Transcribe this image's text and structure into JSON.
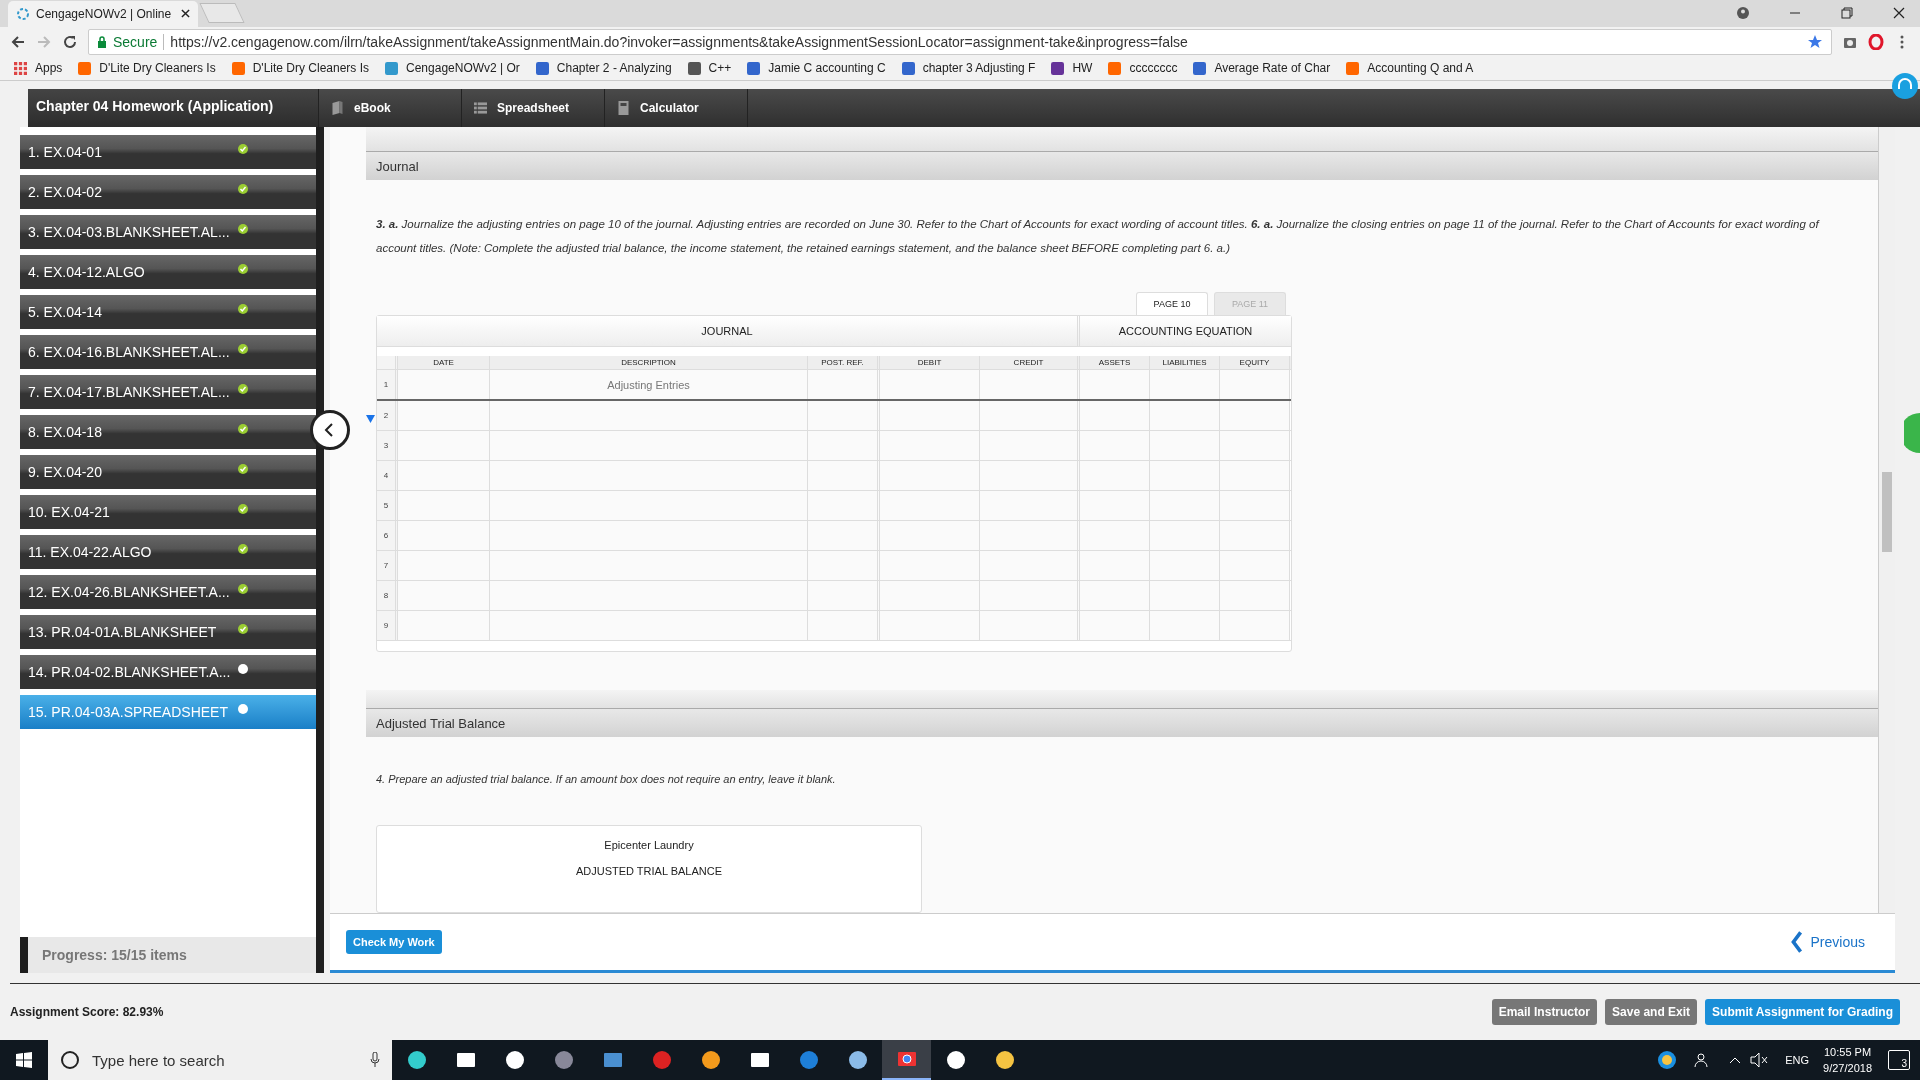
{
  "browser": {
    "tab_title": "CengageNOWv2 | Online",
    "secure_label": "Secure",
    "url": "https://v2.cengagenow.com/ilrn/takeAssignment/takeAssignmentMain.do?invoker=assignments&takeAssignmentSessionLocator=assignment-take&inprogress=false",
    "bookmarks": [
      "Apps",
      "D'Lite Dry Cleaners Is",
      "D'Lite Dry Cleaners Is",
      "CengageNOWv2 | Or",
      "Chapter 2 - Analyzing",
      "C++",
      "Jamie C accounting C",
      "chapter 3 Adjusting F",
      "HW",
      "cccccccc",
      "Average Rate of Char",
      "Accounting Q and A"
    ]
  },
  "assignment_title": "Chapter 04 Homework (Application)",
  "tools": [
    "eBook",
    "Spreadsheet",
    "Calculator"
  ],
  "sidebar": {
    "items": [
      {
        "label": "1. EX.04-01",
        "done": true,
        "selected": false
      },
      {
        "label": "2. EX.04-02",
        "done": true,
        "selected": false
      },
      {
        "label": "3. EX.04-03.BLANKSHEET.AL...",
        "done": true,
        "selected": false
      },
      {
        "label": "4. EX.04-12.ALGO",
        "done": true,
        "selected": false
      },
      {
        "label": "5. EX.04-14",
        "done": true,
        "selected": false
      },
      {
        "label": "6. EX.04-16.BLANKSHEET.AL...",
        "done": true,
        "selected": false
      },
      {
        "label": "7. EX.04-17.BLANKSHEET.AL...",
        "done": true,
        "selected": false
      },
      {
        "label": "8. EX.04-18",
        "done": true,
        "selected": false
      },
      {
        "label": "9. EX.04-20",
        "done": true,
        "selected": false
      },
      {
        "label": "10. EX.04-21",
        "done": true,
        "selected": false
      },
      {
        "label": "11. EX.04-22.ALGO",
        "done": true,
        "selected": false
      },
      {
        "label": "12. EX.04-26.BLANKSHEET.A...",
        "done": true,
        "selected": false
      },
      {
        "label": "13. PR.04-01A.BLANKSHEET",
        "done": true,
        "selected": false
      },
      {
        "label": "14. PR.04-02.BLANKSHEET.A...",
        "done": false,
        "selected": false
      },
      {
        "label": "15. PR.04-03A.SPREADSHEET",
        "done": false,
        "selected": true
      }
    ],
    "progress": "Progress:  15/15 items"
  },
  "journal": {
    "heading": "Journal",
    "instructions": "**3. a.** Journalize the adjusting entries on page 10 of the journal. Adjusting entries are recorded on June 30. Refer to the Chart of Accounts for exact wording of account titles. **6. a.** Journalize the closing entries on page 11 of the journal. Refer to the Chart of Accounts for exact wording of account titles. (Note: Complete the adjusted trial balance, the income statement, the retained earnings statement, and the balance sheet BEFORE completing part 6. a.)",
    "pages": [
      {
        "label": "PAGE 10",
        "selected": true
      },
      {
        "label": "PAGE 11",
        "selected": false
      }
    ],
    "group_headers": [
      "JOURNAL",
      "ACCOUNTING EQUATION"
    ],
    "columns": [
      "DATE",
      "DESCRIPTION",
      "POST. REF.",
      "DEBIT",
      "CREDIT",
      "ASSETS",
      "LIABILITIES",
      "EQUITY"
    ],
    "rows": [
      {
        "number": "1",
        "description": "Adjusting Entries"
      },
      {
        "number": "2"
      },
      {
        "number": "3"
      },
      {
        "number": "4"
      },
      {
        "number": "5"
      },
      {
        "number": "6"
      },
      {
        "number": "7"
      },
      {
        "number": "8"
      },
      {
        "number": "9"
      }
    ]
  },
  "trial_balance": {
    "heading": "Adjusted Trial Balance",
    "instructions": "4. Prepare an adjusted trial balance. If an amount box does not require an entry, leave it blank.",
    "company": "Epicenter Laundry",
    "title": "ADJUSTED TRIAL BALANCE"
  },
  "check_button": "Check My Work",
  "previous_link": "Previous",
  "score": "Assignment Score: 82.93%",
  "footer_buttons": [
    {
      "label": "Email Instructor",
      "kind": "secondary"
    },
    {
      "label": "Save and Exit",
      "kind": "secondary"
    },
    {
      "label": "Submit Assignment for Grading",
      "kind": "primary"
    }
  ],
  "taskbar": {
    "search_placeholder": "Type here to search",
    "apps": [
      {
        "selected": false
      },
      {
        "selected": false
      },
      {
        "selected": false
      },
      {
        "selected": false
      },
      {
        "selected": false
      },
      {
        "selected": false
      },
      {
        "selected": false
      },
      {
        "selected": false
      },
      {
        "selected": false
      },
      {
        "selected": false
      },
      {
        "selected": true
      },
      {
        "selected": false
      },
      {
        "selected": false
      }
    ],
    "language": "ENG",
    "time": "10:55 PM",
    "date": "9/27/2018",
    "notifications": "3"
  }
}
